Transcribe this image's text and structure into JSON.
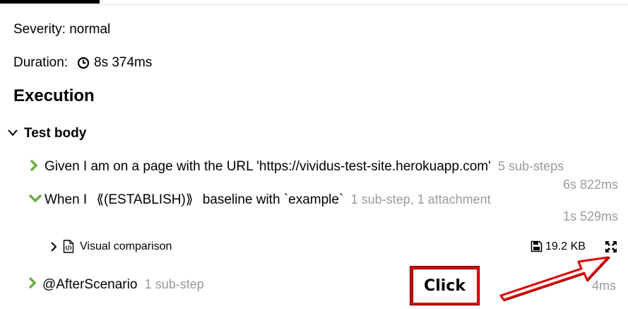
{
  "severity": {
    "label": "Severity: normal"
  },
  "duration": {
    "label": "Duration:",
    "value": "8s 374ms"
  },
  "execution": {
    "heading": "Execution"
  },
  "test_body": {
    "label": "Test body"
  },
  "steps": [
    {
      "text": "Given I am on a page with the URL 'https://vividus-test-site.herokuapp.com'",
      "meta": "5 sub-steps",
      "duration": "6s 822ms"
    },
    {
      "text_prefix": "When I",
      "text_marker": "⟪(ESTABLISH)⟫",
      "text_suffix": "baseline with `example`",
      "meta": "1 sub-step, 1 attachment",
      "duration": "1s 529ms"
    },
    {
      "text": "@AfterScenario",
      "meta": "1 sub-step",
      "duration": "4ms"
    }
  ],
  "attachment": {
    "name": "Visual comparison",
    "size": "19.2 KB"
  },
  "callout": {
    "label": "Click"
  },
  "colors": {
    "green": "#6fae3f",
    "callout_red": "#e00000"
  }
}
